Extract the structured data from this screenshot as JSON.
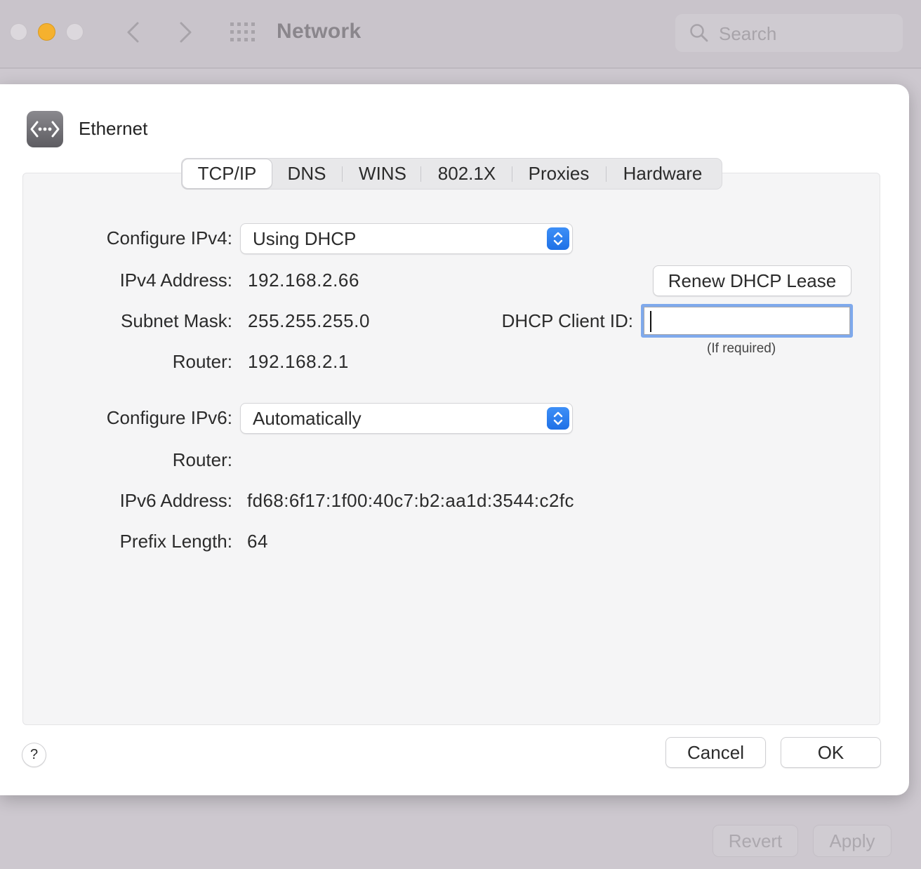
{
  "window": {
    "title": "Network",
    "search_placeholder": "Search",
    "revert_label": "Revert",
    "apply_label": "Apply"
  },
  "sheet": {
    "title": "Ethernet",
    "tabs": [
      {
        "label": "TCP/IP",
        "active": true
      },
      {
        "label": "DNS",
        "active": false
      },
      {
        "label": "WINS",
        "active": false
      },
      {
        "label": "802.1X",
        "active": false
      },
      {
        "label": "Proxies",
        "active": false
      },
      {
        "label": "Hardware",
        "active": false
      }
    ],
    "ipv4": {
      "configure_label": "Configure IPv4:",
      "configure_value": "Using DHCP",
      "address_label": "IPv4 Address:",
      "address_value": "192.168.2.66",
      "subnet_label": "Subnet Mask:",
      "subnet_value": "255.255.255.0",
      "router_label": "Router:",
      "router_value": "192.168.2.1"
    },
    "dhcp": {
      "renew_label": "Renew DHCP Lease",
      "client_id_label": "DHCP Client ID:",
      "client_id_value": "",
      "hint": "(If required)"
    },
    "ipv6": {
      "configure_label": "Configure IPv6:",
      "configure_value": "Automatically",
      "router_label": "Router:",
      "router_value": "",
      "address_label": "IPv6 Address:",
      "address_value": "fd68:6f17:1f00:40c7:b2:aa1d:3544:c2fc",
      "prefix_label": "Prefix Length:",
      "prefix_value": "64"
    },
    "help_label": "?",
    "cancel_label": "Cancel",
    "ok_label": "OK"
  },
  "colors": {
    "accent": "#1f71e6",
    "focus_ring": "#7fa9ec",
    "minimize": "#f5b12e"
  }
}
